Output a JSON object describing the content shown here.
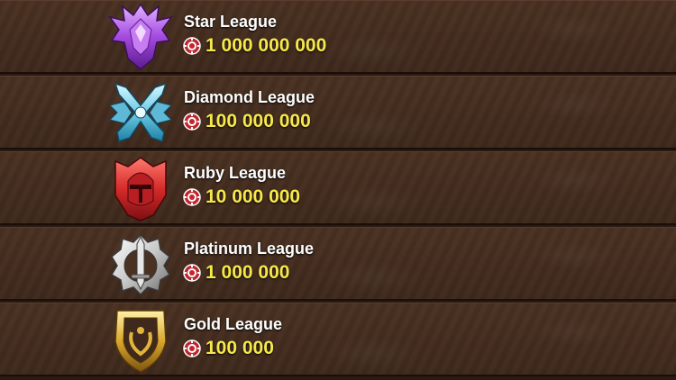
{
  "leagues": [
    {
      "name": "Star League",
      "reward": "1 000 000 000",
      "icon": "purple-crystal-dragon-emblem-icon",
      "color": "#a25bd8"
    },
    {
      "name": "Diamond League",
      "reward": "100 000 000",
      "icon": "crossed-swords-diamond-emblem-icon",
      "color": "#6ccbe6"
    },
    {
      "name": "Ruby League",
      "reward": "10 000 000",
      "icon": "red-knight-helmet-emblem-icon",
      "color": "#d42a2a"
    },
    {
      "name": "Platinum League",
      "reward": "1 000 000",
      "icon": "silver-sword-gear-emblem-icon",
      "color": "#c9c9c9"
    },
    {
      "name": "Gold League",
      "reward": "100 000",
      "icon": "gold-laurel-shield-emblem-icon",
      "color": "#d9a62c"
    }
  ],
  "currency_icon": "poker-chip-icon",
  "colors": {
    "amount": "#f6e84a",
    "title": "#ffffff",
    "background": "#3e291c"
  }
}
